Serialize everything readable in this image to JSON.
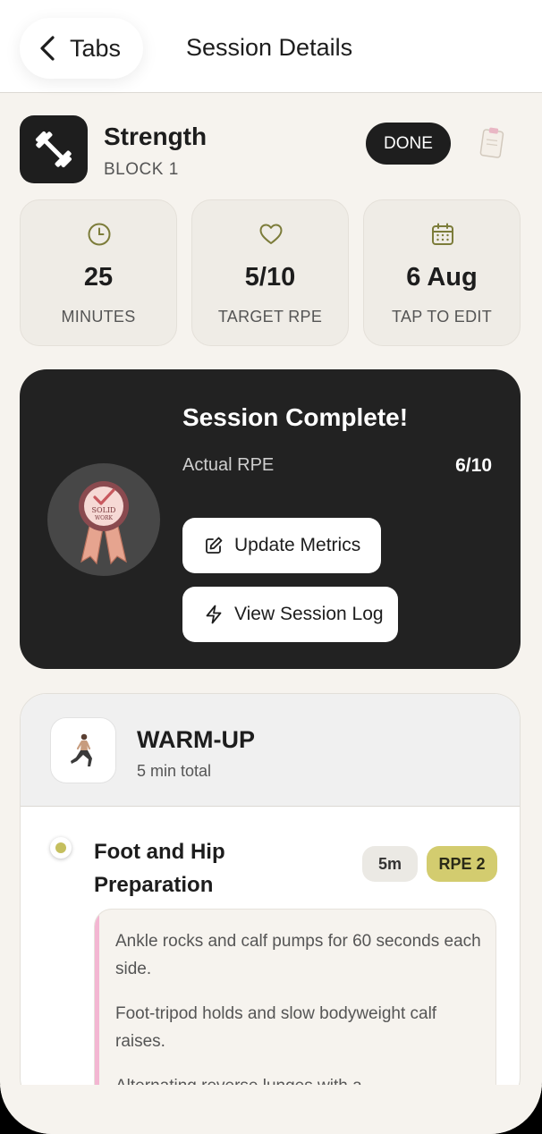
{
  "topbar": {
    "back_label": "Tabs",
    "title": "Session Details"
  },
  "session": {
    "title": "Strength",
    "block": "BLOCK 1",
    "done_label": "DONE",
    "icon": "dumbbell-icon"
  },
  "stats": [
    {
      "value": "25",
      "label": "MINUTES",
      "icon": "clock-icon"
    },
    {
      "value": "5/10",
      "label": "TARGET RPE",
      "icon": "heart-icon"
    },
    {
      "value": "6 Aug",
      "label": "TAP TO EDIT",
      "icon": "calendar-icon"
    }
  ],
  "complete": {
    "title": "Session Complete!",
    "rpe_label": "Actual RPE",
    "rpe_value": "6/10",
    "badge_text": [
      "SOLID",
      "WORK"
    ],
    "update_label": "Update Metrics",
    "log_label": "View Session Log"
  },
  "warmup": {
    "title": "WARM-UP",
    "subtitle": "5 min total",
    "exercise": {
      "name": "Foot and Hip Preparation",
      "duration": "5m",
      "rpe": "RPE 2",
      "notes": [
        "Ankle rocks and calf pumps for 60 seconds each side.",
        "Foot-tripod holds and slow bodyweight calf raises.",
        "Alternating reverse lunges with a"
      ]
    }
  },
  "colors": {
    "background": "#f6f3ee",
    "dark": "#222222",
    "accent_olive": "#8a8a3a",
    "rpe_pill": "#d3cc6f",
    "notes_bar": "#f3b6d2"
  }
}
